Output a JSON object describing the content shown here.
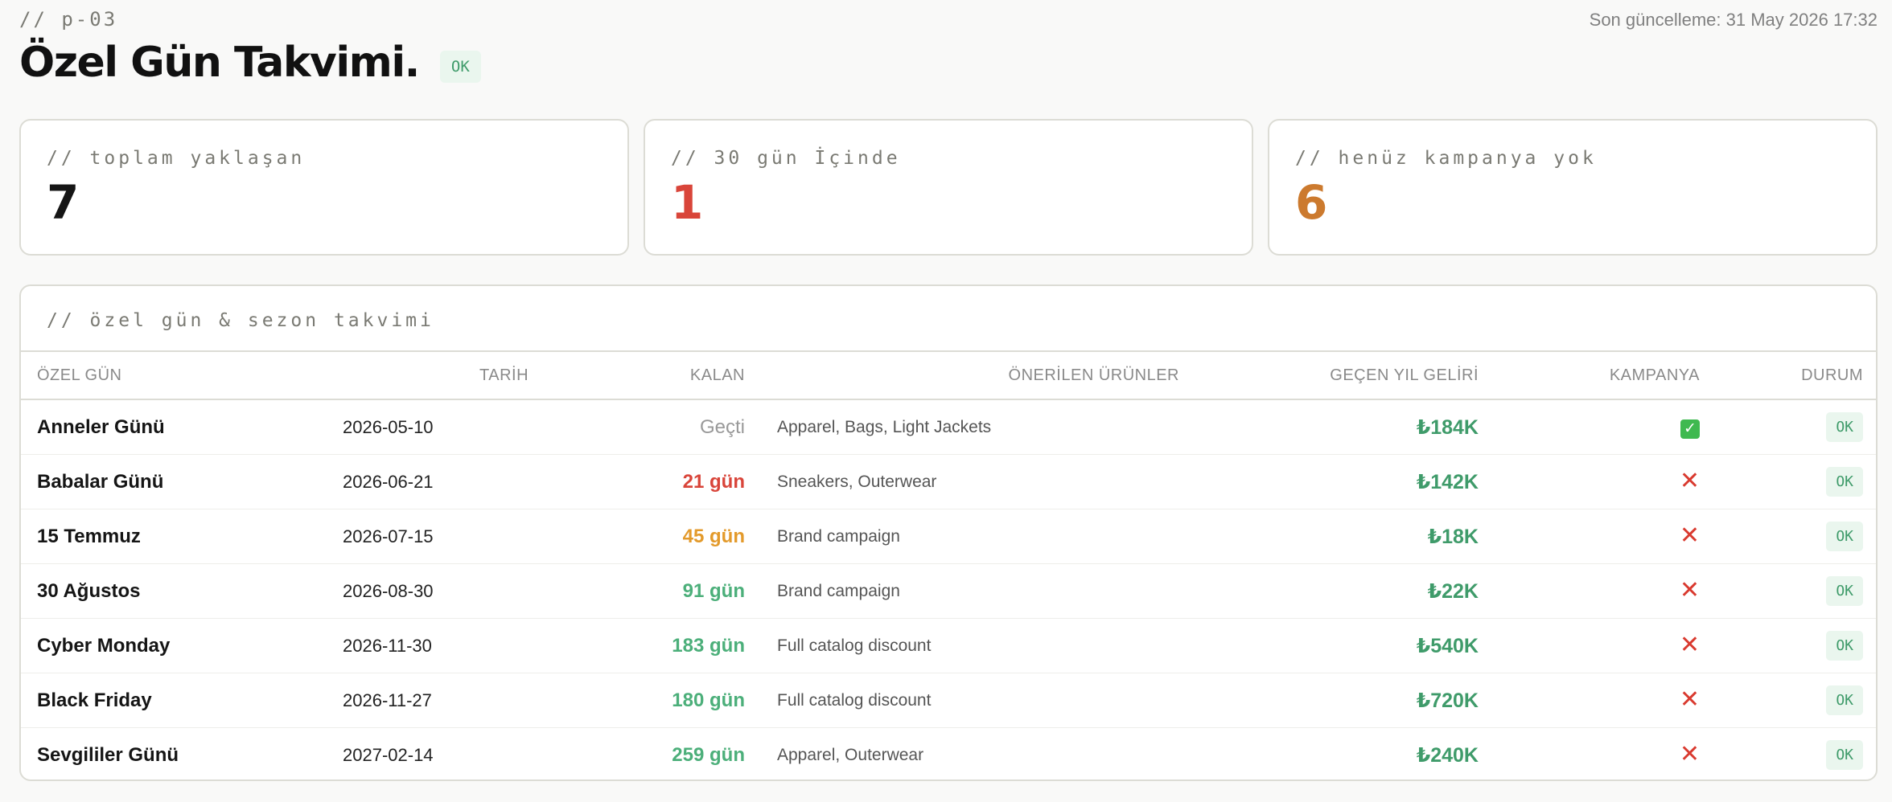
{
  "header": {
    "page_code": "// p-03",
    "last_updated": "Son güncelleme: 31 May 2026 17:32",
    "title": "Özel Gün Takvimi.",
    "status_badge": "OK"
  },
  "cards": [
    {
      "label": "// toplam yaklaşan",
      "value": "7",
      "color": "#151515"
    },
    {
      "label": "// 30 gün İçinde",
      "value": "1",
      "color": "#d9453a"
    },
    {
      "label": "// henüz kampanya yok",
      "value": "6",
      "color": "#cc7a2e"
    }
  ],
  "table": {
    "title": "// özel gün & sezon takvimi",
    "columns": {
      "name": "ÖZEL GÜN",
      "date": "TARİH",
      "remaining": "KALAN",
      "products": "ÖNERİLEN ÜRÜNLER",
      "revenue": "GEÇEN YIL GELİRİ",
      "campaign": "KAMPANYA",
      "status": "DURUM"
    },
    "rows": [
      {
        "name": "Anneler Günü",
        "date": "2026-05-10",
        "remaining": "Geçti",
        "remaining_color": "#999999",
        "remaining_bold": false,
        "products": "Apparel, Bags, Light Jackets",
        "revenue": "₺184K",
        "campaign": "check",
        "status": "OK"
      },
      {
        "name": "Babalar Günü",
        "date": "2026-06-21",
        "remaining": "21 gün",
        "remaining_color": "#d9453a",
        "remaining_bold": true,
        "products": "Sneakers, Outerwear",
        "revenue": "₺142K",
        "campaign": "cross",
        "status": "OK"
      },
      {
        "name": "15 Temmuz",
        "date": "2026-07-15",
        "remaining": "45 gün",
        "remaining_color": "#e39a2b",
        "remaining_bold": true,
        "products": "Brand campaign",
        "revenue": "₺18K",
        "campaign": "cross",
        "status": "OK"
      },
      {
        "name": "30 Ağustos",
        "date": "2026-08-30",
        "remaining": "91 gün",
        "remaining_color": "#4caf7a",
        "remaining_bold": true,
        "products": "Brand campaign",
        "revenue": "₺22K",
        "campaign": "cross",
        "status": "OK"
      },
      {
        "name": "Cyber Monday",
        "date": "2026-11-30",
        "remaining": "183 gün",
        "remaining_color": "#4caf7a",
        "remaining_bold": true,
        "products": "Full catalog discount",
        "revenue": "₺540K",
        "campaign": "cross",
        "status": "OK"
      },
      {
        "name": "Black Friday",
        "date": "2026-11-27",
        "remaining": "180 gün",
        "remaining_color": "#4caf7a",
        "remaining_bold": true,
        "products": "Full catalog discount",
        "revenue": "₺720K",
        "campaign": "cross",
        "status": "OK"
      },
      {
        "name": "Sevgililer Günü",
        "date": "2027-02-14",
        "remaining": "259 gün",
        "remaining_color": "#4caf7a",
        "remaining_bold": true,
        "products": "Apparel, Outerwear",
        "revenue": "₺240K",
        "campaign": "cross",
        "status": "OK"
      }
    ]
  }
}
